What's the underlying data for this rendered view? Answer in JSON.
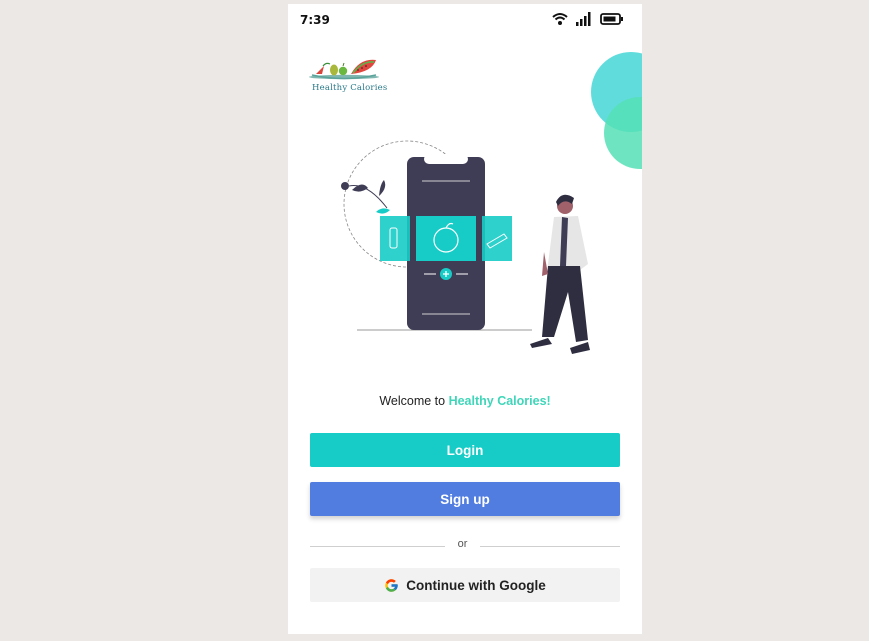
{
  "status_bar": {
    "time": "7:39",
    "icons": [
      "wifi-icon",
      "signal-icon",
      "battery-icon"
    ]
  },
  "logo": {
    "text": "Healthy Calories"
  },
  "welcome": {
    "prefix": "Welcome to ",
    "brand": "Healthy Calories!"
  },
  "buttons": {
    "login": "Login",
    "signup": "Sign up",
    "google": "Continue with Google"
  },
  "divider": {
    "text": "or"
  },
  "colors": {
    "login_bg": "#17ccc6",
    "signup_bg": "#527de0",
    "brand_accent": "#3fd6b9",
    "google_bg": "#f2f2f2"
  }
}
